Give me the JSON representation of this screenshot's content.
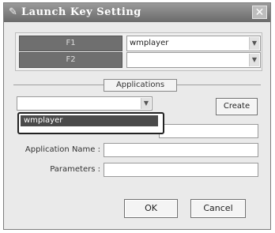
{
  "window": {
    "title": "Launch Key Setting",
    "close_symbol": "✕",
    "icon": "pencil-icon"
  },
  "keys": [
    {
      "label": "F1",
      "value": "wmplayer"
    },
    {
      "label": "F2",
      "value": ""
    }
  ],
  "applications": {
    "group_label": "Applications",
    "selected_value": "",
    "create_label": "Create",
    "dropdown_items": [
      "wmplayer"
    ],
    "application_name_label": "Application Name :",
    "parameters_label": "Parameters :"
  },
  "footer": {
    "ok_label": "OK",
    "cancel_label": "Cancel"
  }
}
